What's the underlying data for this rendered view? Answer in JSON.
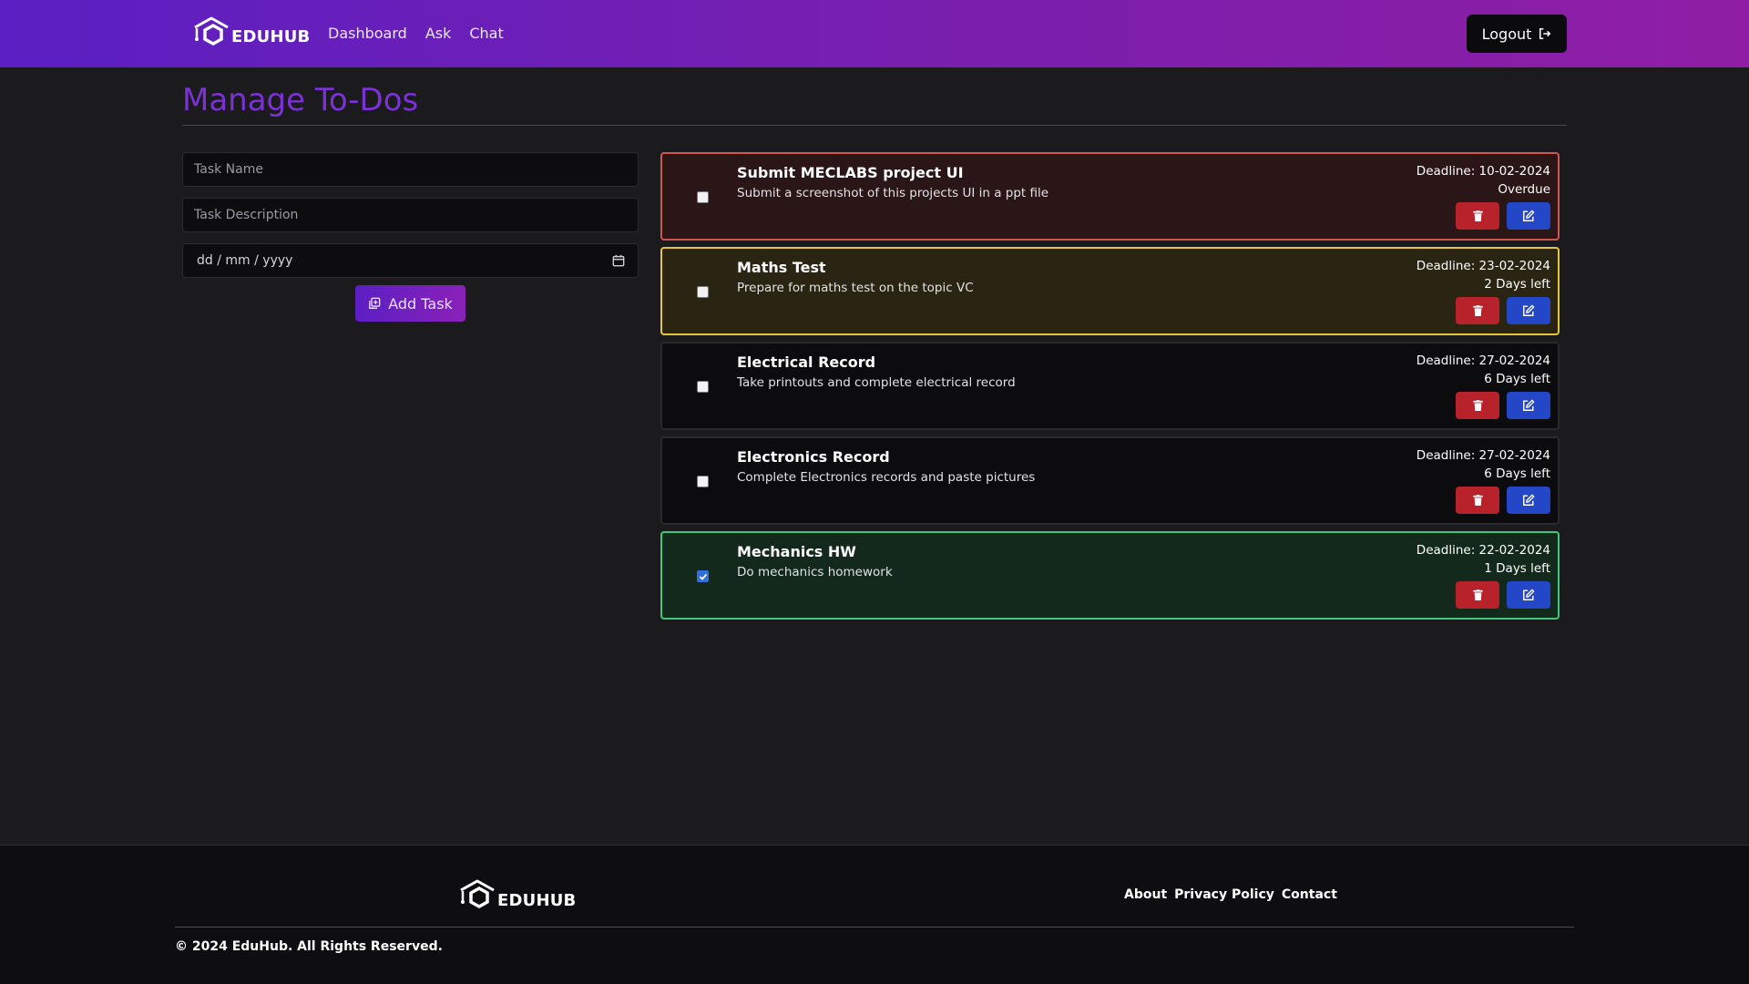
{
  "header": {
    "brand": "EDUHUB",
    "nav": [
      "Dashboard",
      "Ask",
      "Chat"
    ],
    "logout_label": "Logout"
  },
  "page": {
    "title": "Manage To-Dos"
  },
  "form": {
    "task_name_placeholder": "Task Name",
    "task_description_placeholder": "Task Description",
    "date_placeholder": "dd / mm / yyyy",
    "add_button_label": "Add Task"
  },
  "tasks": [
    {
      "name": "Submit MECLABS project UI",
      "description": "Submit a screenshot of this projects UI in a ppt file",
      "deadline": "Deadline: 10-02-2024",
      "status": "Overdue",
      "completed": false,
      "state": "overdue",
      "border_color": "#d0574f"
    },
    {
      "name": "Maths Test",
      "description": "Prepare for maths test on the topic VC",
      "deadline": "Deadline: 23-02-2024",
      "status": "2 Days left",
      "completed": false,
      "state": "soon",
      "border_color": "#e6c53b"
    },
    {
      "name": "Electrical Record",
      "description": "Take printouts and complete electrical record",
      "deadline": "Deadline: 27-02-2024",
      "status": "6 Days left",
      "completed": false,
      "state": "normal",
      "border_color": "#2a2a2e"
    },
    {
      "name": "Electronics Record",
      "description": "Complete Electronics records and paste pictures",
      "deadline": "Deadline: 27-02-2024",
      "status": "6 Days left",
      "completed": false,
      "state": "normal",
      "border_color": "#2a2a2e"
    },
    {
      "name": "Mechanics HW",
      "description": "Do mechanics homework",
      "deadline": "Deadline: 22-02-2024",
      "status": "1 Days left",
      "completed": true,
      "state": "done",
      "border_color": "#3fc879"
    }
  ],
  "footer": {
    "brand": "EDUHUB",
    "links": [
      "About",
      "Privacy Policy",
      "Contact"
    ],
    "copyright": "© 2024 EduHub. All Rights Reserved."
  },
  "colors": {
    "accent_purple": "#7a32d4",
    "header_gradient_start": "#5b1fc3",
    "header_gradient_end": "#8f1ea4",
    "delete_red": "#b8222b",
    "edit_blue": "#2447c8"
  },
  "icons": {
    "logo": "graduation-cap-hexagon-icon",
    "logout": "logout-arrow-icon",
    "calendar": "calendar-icon",
    "add": "copy-plus-icon",
    "delete": "trash-icon",
    "edit": "pencil-square-icon"
  }
}
